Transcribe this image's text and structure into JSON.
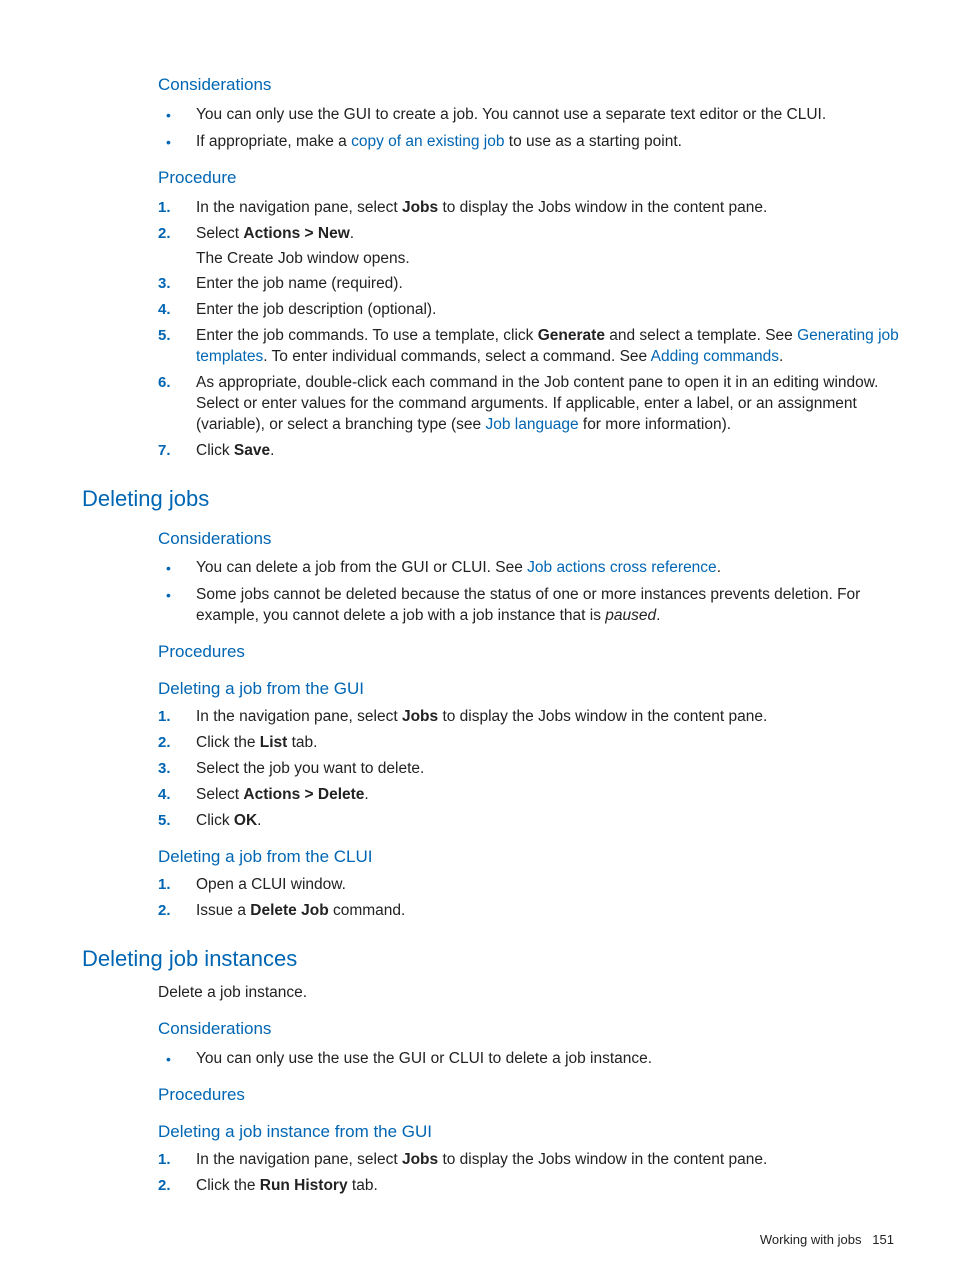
{
  "sec1": {
    "considerations_h": "Considerations",
    "b1_a": "You can only use the GUI to create a job. You cannot use a separate text editor or the CLUI.",
    "b2_a": "If appropriate, make a ",
    "b2_link": "copy of an existing job",
    "b2_b": " to use as a starting point.",
    "procedure_h": "Procedure",
    "s1_a": "In the navigation pane, select ",
    "s1_bold": "Jobs",
    "s1_b": " to display the Jobs window in the content pane.",
    "s2_a": "Select ",
    "s2_bold": "Actions > New",
    "s2_b": ".",
    "s2_sub": "The Create Job window opens.",
    "s3": "Enter the job name (required).",
    "s4": "Enter the job description (optional).",
    "s5_a": "Enter the job commands. To use a template, click ",
    "s5_bold": "Generate",
    "s5_b": " and select a template. See ",
    "s5_link1": "Generating job templates",
    "s5_c": ". To enter individual commands, select a command. See ",
    "s5_link2": "Adding commands",
    "s5_d": ".",
    "s6_a": "As appropriate, double-click each command in the Job content pane to open it in an editing window. Select or enter values for the command arguments. If applicable, enter a label, or an assignment (variable), or select a branching type (see ",
    "s6_link": "Job language",
    "s6_b": " for more information).",
    "s7_a": "Click ",
    "s7_bold": "Save",
    "s7_b": "."
  },
  "sec2": {
    "title": "Deleting jobs",
    "considerations_h": "Considerations",
    "b1_a": "You can delete a job from the GUI or CLUI. See ",
    "b1_link": "Job actions cross reference",
    "b1_b": ".",
    "b2_a": "Some jobs cannot be deleted because the status of one or more instances prevents deletion. For example, you cannot delete a job with a job instance that is ",
    "b2_ital": "paused",
    "b2_b": ".",
    "procedures_h": "Procedures",
    "sub1_h": "Deleting a job from the GUI",
    "s1_a": "In the navigation pane, select ",
    "s1_bold": "Jobs",
    "s1_b": " to display the Jobs window in the content pane.",
    "s2_a": "Click the ",
    "s2_bold": "List",
    "s2_b": " tab.",
    "s3": "Select the job you want to delete.",
    "s4_a": "Select ",
    "s4_bold": "Actions > Delete",
    "s4_b": ".",
    "s5_a": "Click ",
    "s5_bold": "OK",
    "s5_b": ".",
    "sub2_h": "Deleting a job from the CLUI",
    "c1": "Open a CLUI window.",
    "c2_a": "Issue a ",
    "c2_bold": "Delete Job",
    "c2_b": " command."
  },
  "sec3": {
    "title": "Deleting job instances",
    "intro": "Delete a job instance.",
    "considerations_h": "Considerations",
    "b1": "You can only use the use the GUI or CLUI to delete a job instance.",
    "procedures_h": "Procedures",
    "sub1_h": "Deleting a job instance from the GUI",
    "s1_a": "In the navigation pane, select ",
    "s1_bold": "Jobs",
    "s1_b": " to display the Jobs window in the content pane.",
    "s2_a": "Click the ",
    "s2_bold": "Run History",
    "s2_b": " tab."
  },
  "footer": {
    "text": "Working with jobs",
    "page": "151"
  }
}
